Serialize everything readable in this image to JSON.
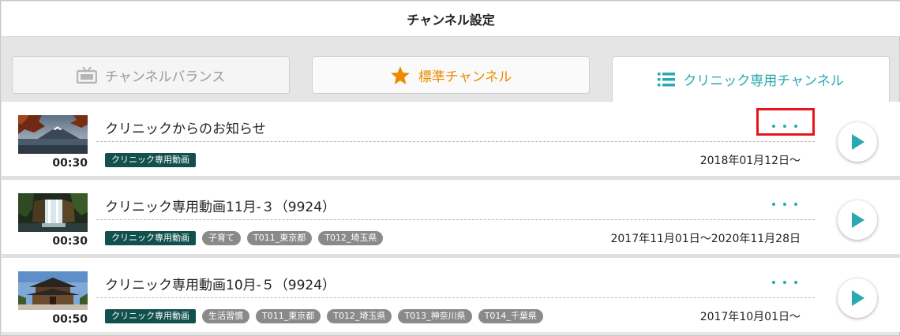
{
  "header": {
    "title": "チャンネル設定"
  },
  "tabs": [
    {
      "label": "チャンネルバランス",
      "icon": "tv-icon",
      "state": "inactive"
    },
    {
      "label": "標準チャンネル",
      "icon": "star-icon",
      "state": "inactive"
    },
    {
      "label": "クリニック専用チャンネル",
      "icon": "list-icon",
      "state": "active"
    }
  ],
  "colors": {
    "accent": "#29aab0",
    "orange": "#ee8a00",
    "tag_dark": "#11504c",
    "tag_gray": "#8a8a8a",
    "highlight": "#e8141b"
  },
  "items": [
    {
      "title": "クリニックからのお知らせ",
      "duration": "00:30",
      "date": "2018年01月12日〜",
      "tags": [
        "クリニック専用動画"
      ],
      "thumbnail": "mountain-lake-thumbnail"
    },
    {
      "title": "クリニック専用動画11月-３（9924）",
      "duration": "00:30",
      "date": "2017年11月01日〜2020年11月28日",
      "tags": [
        "クリニック専用動画",
        "子育て",
        "T011_東京都",
        "T012_埼玉県"
      ],
      "thumbnail": "waterfall-thumbnail"
    },
    {
      "title": "クリニック専用動画10月-５（9924）",
      "duration": "00:50",
      "date": "2017年10月01日〜",
      "tags": [
        "クリニック専用動画",
        "生活習慣",
        "T011_東京都",
        "T012_埼玉県",
        "T013_神奈川県",
        "T014_千葉県"
      ],
      "thumbnail": "temple-thumbnail"
    }
  ]
}
